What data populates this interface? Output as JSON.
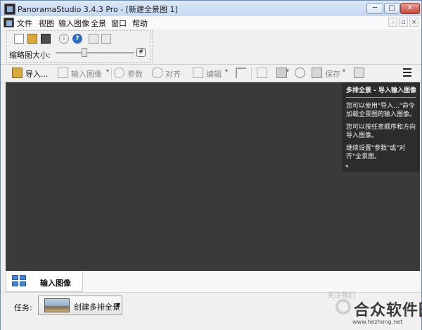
{
  "window": {
    "title": "PanoramaStudio 3.4.3 Pro - [新建全景图 1]",
    "min_glyph": "─",
    "max_glyph": "□",
    "close_glyph": "✕"
  },
  "menu": {
    "items": [
      "文件",
      "视图",
      "输入图像",
      "全景",
      "窗口",
      "帮助"
    ],
    "mdi": [
      "-",
      "▫",
      "×"
    ]
  },
  "ribbon": {
    "thumb_size_label": "缩略图大小:",
    "zoom_glyph": "#",
    "info_glyph": "i",
    "help_glyph": "?"
  },
  "toolbar": {
    "import": "导入...",
    "input_image": "输入图像",
    "params": "参数",
    "align": "对齐",
    "edit": "编辑",
    "save": "保存",
    "dropdown_glyph": "▾"
  },
  "panel": {
    "title": "多排全景 - 导入输入图像",
    "p1": "您可以使用\"导入...\"命令加载全景图的输入图像。",
    "p2": "您可以按任意顺序和方向导入图像。",
    "p3": "继续设置\"参数\"或\"对齐\"全景图。",
    "expand_glyph": "⌝"
  },
  "tabs": {
    "input_images": "输入图像"
  },
  "status": {
    "task_label": "任务:",
    "task_value": "创建多排全景",
    "task_arrow": "▼"
  },
  "watermark": {
    "faint": "关注我们",
    "text": "合众软件园",
    "url": "www.hezhong.net"
  },
  "colors": {
    "workspace": "#3a3a3a",
    "panel": "#2c2c2c",
    "accent": "#3f86d4"
  }
}
